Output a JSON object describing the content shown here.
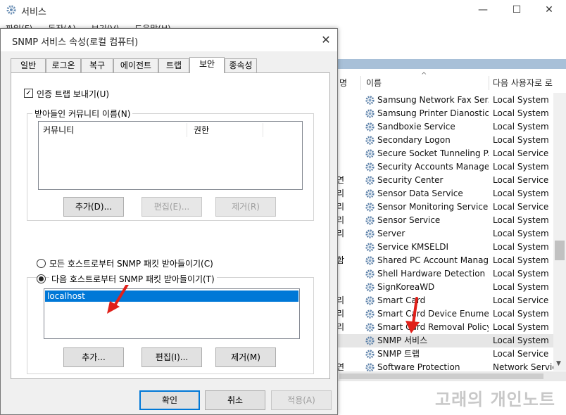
{
  "background_window": {
    "title": "서비스",
    "menu": [
      "파일(F)",
      "동작(A)",
      "보기(V)",
      "도움말(H)"
    ],
    "window_controls": {
      "minimize": "—",
      "maximize": "☐",
      "close": "✕"
    },
    "columns": {
      "name": "이름",
      "logon_as": "다음 사용자로 로",
      "left_partial": "명"
    },
    "services": [
      {
        "frag": "",
        "name": "Samsung Network Fax Ser...",
        "logon": "Local System"
      },
      {
        "frag": "",
        "name": "Samsung Printer Dianostic...",
        "logon": "Local System"
      },
      {
        "frag": "",
        "name": "Sandboxie Service",
        "logon": "Local System"
      },
      {
        "frag": "",
        "name": "Secondary Logon",
        "logon": "Local System"
      },
      {
        "frag": "",
        "name": "Secure Socket Tunneling P...",
        "logon": "Local Service"
      },
      {
        "frag": "",
        "name": "Security Accounts Manager",
        "logon": "Local System"
      },
      {
        "frag": "연",
        "name": "Security Center",
        "logon": "Local Service"
      },
      {
        "frag": "리",
        "name": "Sensor Data Service",
        "logon": "Local System"
      },
      {
        "frag": "리",
        "name": "Sensor Monitoring Service",
        "logon": "Local Service"
      },
      {
        "frag": "리",
        "name": "Sensor Service",
        "logon": "Local System"
      },
      {
        "frag": "리",
        "name": "Server",
        "logon": "Local System"
      },
      {
        "frag": "",
        "name": "Service KMSELDI",
        "logon": "Local System"
      },
      {
        "frag": "함",
        "name": "Shared PC Account Manager",
        "logon": "Local System"
      },
      {
        "frag": "",
        "name": "Shell Hardware Detection",
        "logon": "Local System"
      },
      {
        "frag": "",
        "name": "SignKoreaWD",
        "logon": "Local System"
      },
      {
        "frag": "리",
        "name": "Smart Card",
        "logon": "Local Service"
      },
      {
        "frag": "리",
        "name": "Smart Card Device Enumer...",
        "logon": "Local System"
      },
      {
        "frag": "리",
        "name": "Smart Card Removal Policy",
        "logon": "Local System"
      },
      {
        "frag": "",
        "name": "SNMP 서비스",
        "logon": "Local System",
        "selected": true
      },
      {
        "frag": "",
        "name": "SNMP 트랩",
        "logon": "Local Service"
      },
      {
        "frag": "연",
        "name": "Software Protection",
        "logon": "Network Service"
      }
    ],
    "watermark": "고래의 개인노트"
  },
  "dialog": {
    "title": "SNMP 서비스 속성(로컬 컴퓨터)",
    "close_glyph": "✕",
    "tabs": [
      "일반",
      "로그온",
      "복구",
      "에이전트",
      "트랩",
      "보안",
      "종속성"
    ],
    "active_tab": "보안",
    "send_auth_trap": {
      "label": "인증 트랩 보내기(U)",
      "checked": true
    },
    "communities": {
      "group_label": "받아들인 커뮤니티 이름(N)",
      "columns": [
        "커뮤니티",
        "권한"
      ],
      "add": "추가(D)...",
      "edit": "편집(E)...",
      "remove": "제거(R)"
    },
    "hosts": {
      "any_label": "모든 호스트로부터 SNMP 패킷 받아들이기(C)",
      "these_label": "다음 호스트로부터 SNMP 패킷 받아들이기(T)",
      "selected_option": "these",
      "list": [
        "localhost"
      ],
      "add": "추가...",
      "edit": "편집(I)...",
      "remove": "제거(M)"
    },
    "footer": {
      "ok": "확인",
      "cancel": "취소",
      "apply": "적용(A)"
    }
  },
  "colors": {
    "accent": "#0078d7",
    "annotation_arrow": "#e0201a"
  },
  "icons": [
    "gear-icon",
    "service-gear-icon",
    "check-icon",
    "close-icon",
    "sort-caret-icon",
    "arrow-annotation-icon"
  ]
}
